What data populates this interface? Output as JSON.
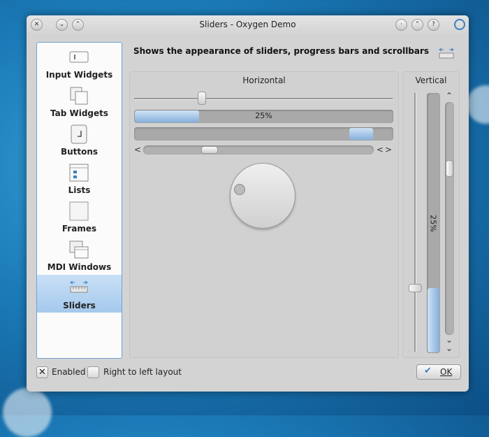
{
  "window": {
    "title": "Sliders - Oxygen Demo"
  },
  "titlebar": {
    "close_icon": "close-icon",
    "minimize_icon": "chevron-down-icon",
    "maximize_icon": "chevron-up-icon"
  },
  "sidebar": {
    "items": [
      {
        "label": "Input Widgets",
        "icon": "input-widgets-icon"
      },
      {
        "label": "Tab Widgets",
        "icon": "tab-widgets-icon"
      },
      {
        "label": "Buttons",
        "icon": "buttons-icon"
      },
      {
        "label": "Lists",
        "icon": "lists-icon"
      },
      {
        "label": "Frames",
        "icon": "frames-icon"
      },
      {
        "label": "MDI Windows",
        "icon": "mdi-windows-icon"
      },
      {
        "label": "Sliders",
        "icon": "sliders-icon",
        "selected": true
      }
    ]
  },
  "header": {
    "description": "Shows the appearance of sliders, progress bars and scrollbars"
  },
  "horizontal": {
    "title": "Horizontal",
    "slider_value": 0.26,
    "progress_value": 0.25,
    "progress_text": "25%",
    "busy_position": 0.92,
    "scrollbar_position": 0.27,
    "scroll_left": "<",
    "scroll_right": ">",
    "scroll_left_alt": "<"
  },
  "vertical": {
    "title": "Vertical",
    "slider_value": 0.25,
    "progress_value": 0.25,
    "progress_text": "25%",
    "scrollbar_position": 0.27,
    "scroll_up": "^",
    "scroll_down": "v",
    "scroll_down_alt": "v"
  },
  "footer": {
    "enabled_label": "Enabled",
    "enabled_checked": true,
    "rtl_label": "Right to left layout",
    "rtl_checked": false,
    "ok_label": "OK"
  },
  "colors": {
    "accent": "#3d7fc2",
    "selection": "#a5c9ec"
  }
}
